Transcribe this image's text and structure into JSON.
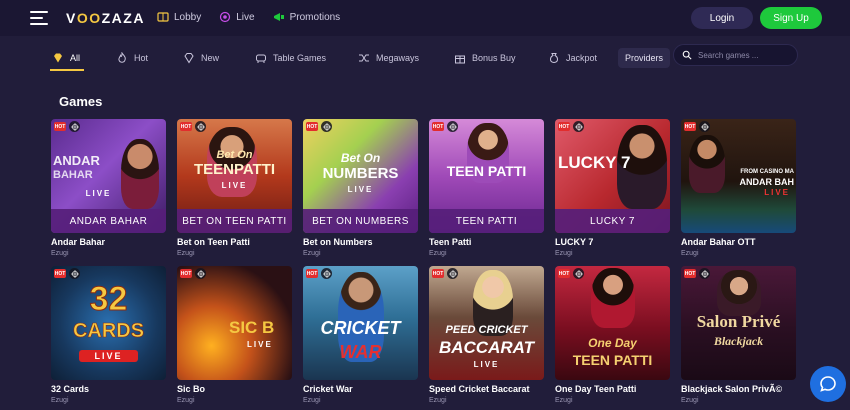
{
  "brand": {
    "logo_a": "V",
    "logo_b": "OO",
    "logo_c": "ZAZA"
  },
  "topnav": [
    {
      "label": "Lobby",
      "icon": "lobby-icon"
    },
    {
      "label": "Live",
      "icon": "live-icon"
    },
    {
      "label": "Promotions",
      "icon": "megaphone-icon"
    }
  ],
  "auth": {
    "login": "Login",
    "signup": "Sign Up"
  },
  "categories": [
    {
      "label": "All",
      "icon": "diamond-icon",
      "active": true
    },
    {
      "label": "Hot",
      "icon": "flame-icon"
    },
    {
      "label": "New",
      "icon": "diamond-outline-icon"
    },
    {
      "label": "Table Games",
      "icon": "table-games-icon"
    },
    {
      "label": "Megaways",
      "icon": "shuffle-icon"
    },
    {
      "label": "Bonus Buy",
      "icon": "gift-icon"
    },
    {
      "label": "Jackpot",
      "icon": "money-bag-icon"
    }
  ],
  "providers_label": "Providers",
  "search": {
    "placeholder": "Search games ..."
  },
  "section_title": "Games",
  "badge_hot": "HOT",
  "games": [
    {
      "name": "Andar Bahar",
      "provider": "Ezugi",
      "thumb_title": "ANDAR",
      "thumb_sub": "BAHAR",
      "thumb_live": "LIVE",
      "band": "ANDAR BAHAR"
    },
    {
      "name": "Bet on Teen Patti",
      "provider": "Ezugi",
      "thumb_title": "Bet On",
      "thumb_sub": "TEENPATTI",
      "thumb_live": "LIVE",
      "band": "BET ON TEEN PATTI"
    },
    {
      "name": "Bet on Numbers",
      "provider": "Ezugi",
      "thumb_title": "Bet On",
      "thumb_sub": "NUMBERS",
      "thumb_live": "LIVE",
      "band": "BET ON NUMBERS"
    },
    {
      "name": "Teen Patti",
      "provider": "Ezugi",
      "thumb_title": "TEEN PATTI",
      "thumb_sub": "",
      "thumb_live": "",
      "band": "TEEN PATTI"
    },
    {
      "name": "LUCKY 7",
      "provider": "Ezugi",
      "thumb_title": "LUCKY 7",
      "thumb_sub": "",
      "thumb_live": "",
      "band": "LUCKY 7"
    },
    {
      "name": "Andar Bahar OTT",
      "provider": "Ezugi",
      "thumb_title": "FROM CASINO MA",
      "thumb_sub": "ANDAR BAH",
      "thumb_live": "LIVE",
      "band": ""
    },
    {
      "name": "32 Cards",
      "provider": "Ezugi",
      "thumb_title": "32",
      "thumb_sub": "CARDS",
      "thumb_live": "LIVE",
      "band": ""
    },
    {
      "name": "Sic Bo",
      "provider": "Ezugi",
      "thumb_title": "SIC B",
      "thumb_sub": "",
      "thumb_live": "LIVE",
      "band": ""
    },
    {
      "name": "Cricket War",
      "provider": "Ezugi",
      "thumb_title": "CRICKET",
      "thumb_sub": "WAR",
      "thumb_live": "",
      "band": ""
    },
    {
      "name": "Speed Cricket Baccarat",
      "provider": "Ezugi",
      "thumb_title": "PEED CRICKET",
      "thumb_sub": "BACCARAT",
      "thumb_live": "LIVE",
      "band": ""
    },
    {
      "name": "One Day Teen Patti",
      "provider": "Ezugi",
      "thumb_title": "One Day",
      "thumb_sub": "TEEN PATTI",
      "thumb_live": "",
      "band": ""
    },
    {
      "name": "Blackjack Salon PrivÃ©",
      "provider": "Ezugi",
      "thumb_title": "Salon Privé",
      "thumb_sub": "Blackjack",
      "thumb_live": "",
      "band": ""
    }
  ],
  "colors": {
    "bg": "#211d3a",
    "topbar": "#1b1733",
    "accent": "#f5c842",
    "signup": "#1ec93c",
    "hot": "#e22d2d",
    "chat": "#1f6fe0"
  }
}
